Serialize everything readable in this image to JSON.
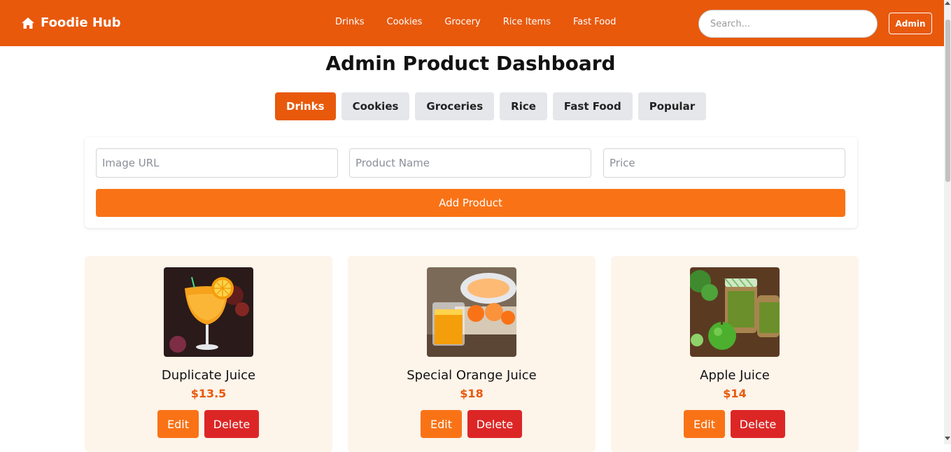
{
  "navbar": {
    "brand": "Foodie Hub",
    "brand_icon": "home-icon",
    "links": [
      "Drinks",
      "Cookies",
      "Grocery",
      "Rice Items",
      "Fast Food"
    ],
    "search_placeholder": "Search...",
    "admin_label": "Admin",
    "accent_color": "#e8590c"
  },
  "page": {
    "title": "Admin Product Dashboard"
  },
  "tabs": [
    {
      "label": "Drinks",
      "active": true
    },
    {
      "label": "Cookies",
      "active": false
    },
    {
      "label": "Groceries",
      "active": false
    },
    {
      "label": "Rice",
      "active": false
    },
    {
      "label": "Fast Food",
      "active": false
    },
    {
      "label": "Popular",
      "active": false
    }
  ],
  "form": {
    "image_url_placeholder": "Image URL",
    "product_name_placeholder": "Product Name",
    "price_placeholder": "Price",
    "submit_label": "Add Product"
  },
  "products": [
    {
      "name": "Duplicate Juice",
      "price": "$13.5",
      "image_icon": "orange-cocktail-image",
      "edit_label": "Edit",
      "delete_label": "Delete"
    },
    {
      "name": "Special Orange Juice",
      "price": "$18",
      "image_icon": "orange-juice-glass-image",
      "edit_label": "Edit",
      "delete_label": "Delete"
    },
    {
      "name": "Apple Juice",
      "price": "$14",
      "image_icon": "green-apple-juice-jars-image",
      "edit_label": "Edit",
      "delete_label": "Delete"
    }
  ],
  "colors": {
    "primary": "#e8590c",
    "button": "#f97316",
    "danger": "#dc2626",
    "card_bg": "#fdf4ea",
    "tab_bg": "#e5e7eb"
  }
}
